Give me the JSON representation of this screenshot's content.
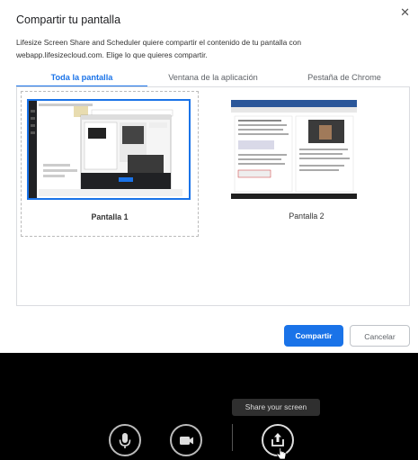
{
  "dialog": {
    "title": "Compartir tu pantalla",
    "description": "Lifesize Screen Share and Scheduler quiere compartir el contenido de tu pantalla con webapp.lifesizecloud.com. Elige lo que quieres compartir.",
    "tabs": [
      {
        "label": "Toda la pantalla",
        "active": true
      },
      {
        "label": "Ventana de la aplicación",
        "active": false
      },
      {
        "label": "Pestaña de Chrome",
        "active": false
      }
    ],
    "sources": [
      {
        "label": "Pantalla 1",
        "selected": true
      },
      {
        "label": "Pantalla 2",
        "selected": false
      }
    ],
    "share_button": "Compartir",
    "cancel_button": "Cancelar",
    "close_icon": "close-icon"
  },
  "call_bar": {
    "tooltip": "Share your screen",
    "controls": [
      {
        "name": "microphone",
        "icon": "microphone-icon"
      },
      {
        "name": "camera",
        "icon": "video-camera-icon"
      },
      {
        "name": "share-screen",
        "icon": "share-screen-icon"
      }
    ]
  },
  "colors": {
    "accent": "#1a73e8",
    "call_bar_bg": "#000000"
  }
}
